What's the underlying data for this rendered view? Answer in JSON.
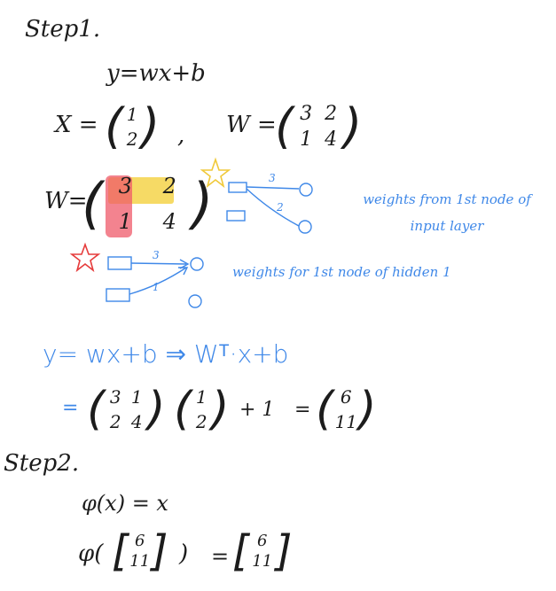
{
  "step1": {
    "title": "Step1.",
    "equation": "y=wx+b",
    "x_label": "X =",
    "x_vector": [
      "1",
      "2"
    ],
    "comma": ",",
    "w_label": "W =",
    "w_matrix": [
      "3",
      "2",
      "1",
      "4"
    ],
    "w2_label": "W=",
    "w2_matrix": [
      "3",
      "2",
      "1",
      "4"
    ],
    "note_input": "weights from 1st node of input layer",
    "diagram_top": {
      "edge1": "3",
      "edge2": "2"
    },
    "diagram_bottom": {
      "edge1": "3",
      "edge2": "1"
    },
    "note_hidden": "weights for 1st node of hidden 1",
    "blue_eq": "y= wx+b ⇒ Wᵀ·x+b",
    "calc": {
      "lhs_eq": "=",
      "matrix": [
        "3",
        "1",
        "2",
        "4"
      ],
      "vector": [
        "1",
        "2"
      ],
      "plus": "+ 1",
      "eq": "=",
      "result": [
        "6",
        "11"
      ]
    }
  },
  "step2": {
    "title": "Step2.",
    "line1": "φ(x) = x",
    "line2_lhs": "φ(",
    "line2_vec": [
      "6",
      "11"
    ],
    "line2_rhs": ")",
    "line2_eq": "=",
    "result": [
      "6",
      "11"
    ]
  },
  "colors": {
    "ink": "#1c1c1c",
    "blue": "#3f88e8",
    "highlight_row": "#f5d34a",
    "highlight_col": "#ef5a6a",
    "star_yellow": "#f0c93a",
    "star_red": "#e63b3b"
  }
}
